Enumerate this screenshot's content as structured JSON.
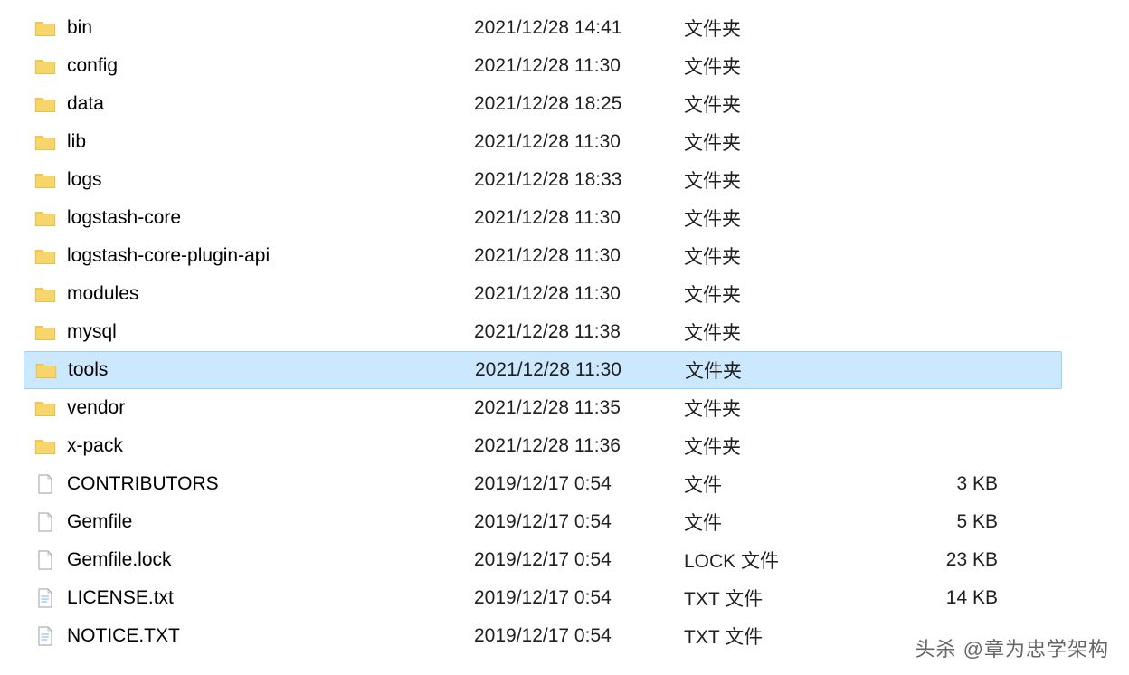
{
  "files": [
    {
      "name": "bin",
      "date": "2021/12/28 14:41",
      "type": "文件夹",
      "size": "",
      "icon": "folder"
    },
    {
      "name": "config",
      "date": "2021/12/28 11:30",
      "type": "文件夹",
      "size": "",
      "icon": "folder"
    },
    {
      "name": "data",
      "date": "2021/12/28 18:25",
      "type": "文件夹",
      "size": "",
      "icon": "folder"
    },
    {
      "name": "lib",
      "date": "2021/12/28 11:30",
      "type": "文件夹",
      "size": "",
      "icon": "folder"
    },
    {
      "name": "logs",
      "date": "2021/12/28 18:33",
      "type": "文件夹",
      "size": "",
      "icon": "folder"
    },
    {
      "name": "logstash-core",
      "date": "2021/12/28 11:30",
      "type": "文件夹",
      "size": "",
      "icon": "folder"
    },
    {
      "name": "logstash-core-plugin-api",
      "date": "2021/12/28 11:30",
      "type": "文件夹",
      "size": "",
      "icon": "folder"
    },
    {
      "name": "modules",
      "date": "2021/12/28 11:30",
      "type": "文件夹",
      "size": "",
      "icon": "folder"
    },
    {
      "name": "mysql",
      "date": "2021/12/28 11:38",
      "type": "文件夹",
      "size": "",
      "icon": "folder"
    },
    {
      "name": "tools",
      "date": "2021/12/28 11:30",
      "type": "文件夹",
      "size": "",
      "icon": "folder",
      "selected": true
    },
    {
      "name": "vendor",
      "date": "2021/12/28 11:35",
      "type": "文件夹",
      "size": "",
      "icon": "folder"
    },
    {
      "name": "x-pack",
      "date": "2021/12/28 11:36",
      "type": "文件夹",
      "size": "",
      "icon": "folder"
    },
    {
      "name": "CONTRIBUTORS",
      "date": "2019/12/17 0:54",
      "type": "文件",
      "size": "3 KB",
      "icon": "file"
    },
    {
      "name": "Gemfile",
      "date": "2019/12/17 0:54",
      "type": "文件",
      "size": "5 KB",
      "icon": "file"
    },
    {
      "name": "Gemfile.lock",
      "date": "2019/12/17 0:54",
      "type": "LOCK 文件",
      "size": "23 KB",
      "icon": "file"
    },
    {
      "name": "LICENSE.txt",
      "date": "2019/12/17 0:54",
      "type": "TXT 文件",
      "size": "14 KB",
      "icon": "txt"
    },
    {
      "name": "NOTICE.TXT",
      "date": "2019/12/17 0:54",
      "type": "TXT 文件",
      "size": "",
      "icon": "txt"
    }
  ],
  "watermark": "头杀 @章为忠学架构"
}
